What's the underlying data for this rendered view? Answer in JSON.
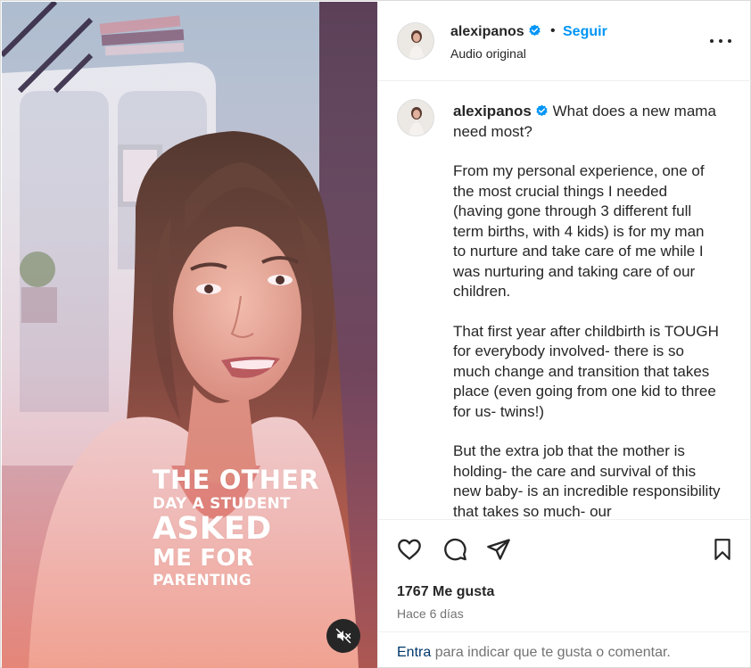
{
  "post": {
    "username": "alexipanos",
    "separator": "•",
    "follow_label": "Seguir",
    "audio_label": "Audio original",
    "more_icon": "more-options-icon",
    "verified_icon": "verified-badge-icon"
  },
  "video": {
    "overlay_lines": [
      "THE OTHER",
      "DAY A STUDENT",
      "ASKED",
      "ME FOR",
      "PARENTING"
    ],
    "mute_icon": "speaker-muted-icon"
  },
  "caption": {
    "username": "alexipanos",
    "first_line": "What does a new mama need most?",
    "paragraph_1": "From my personal experience, one of the most crucial things I needed (having gone through 3 different full term births, with 4 kids) is for my man to nurture and take care of me while I was nurturing and taking care of our children.",
    "paragraph_2": "That first year after childbirth is TOUGH for everybody involved- there is so much change and transition that takes place (even going from one kid to three for us- twins!)",
    "paragraph_3": "But the extra job that the mother is holding- the care and survival of this new baby- is an incredible responsibility that takes so much- our"
  },
  "actions": {
    "like_icon": "heart-icon",
    "comment_icon": "comment-icon",
    "share_icon": "share-icon",
    "save_icon": "bookmark-icon",
    "likes_text": "1767 Me gusta",
    "date_text": "Hace 6 días"
  },
  "comment_bar": {
    "login_link": "Entra",
    "prompt": " para indicar que te gusta o comentar."
  },
  "colors": {
    "accent": "#0095f6",
    "link": "#00376b",
    "muted_text": "#737373",
    "text": "#262626"
  }
}
